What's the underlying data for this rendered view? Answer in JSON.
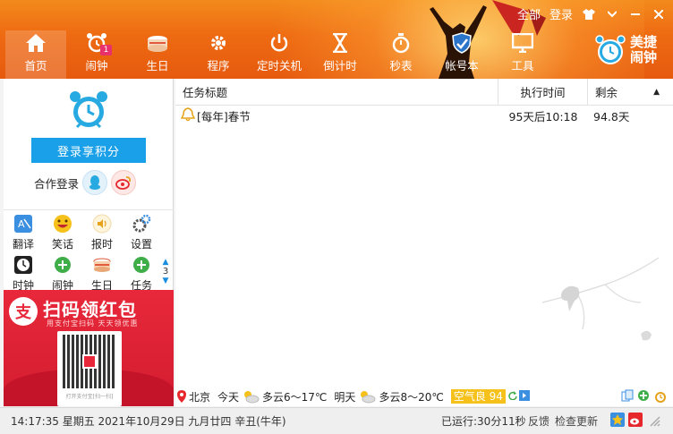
{
  "titlebar": {
    "all": "全部",
    "login": "登录"
  },
  "nav": {
    "items": [
      {
        "label": "首页",
        "icon": "home-icon"
      },
      {
        "label": "闹钟",
        "icon": "alarm-clock-icon",
        "badge": "1"
      },
      {
        "label": "生日",
        "icon": "cake-icon"
      },
      {
        "label": "程序",
        "icon": "gear-icon"
      },
      {
        "label": "定时关机",
        "icon": "power-icon"
      },
      {
        "label": "倒计时",
        "icon": "hourglass-icon"
      },
      {
        "label": "秒表",
        "icon": "stopwatch-icon"
      },
      {
        "label": "帐号本",
        "icon": "shield-icon"
      },
      {
        "label": "工具",
        "icon": "monitor-icon"
      }
    ],
    "brand": "美捷闹钟"
  },
  "left": {
    "login_button": "登录享积分",
    "coop_login": "合作登录",
    "tools_row1": [
      {
        "label": "翻译",
        "icon": "translate-icon"
      },
      {
        "label": "笑话",
        "icon": "smiley-icon"
      },
      {
        "label": "报时",
        "icon": "speaker-icon"
      },
      {
        "label": "设置",
        "icon": "settings-icon"
      }
    ],
    "tools_row2": [
      {
        "label": "时钟",
        "icon": "clock-icon"
      },
      {
        "label": "闹钟",
        "icon": "plus-circle-icon"
      },
      {
        "label": "生日",
        "icon": "cake-icon"
      },
      {
        "label": "任务",
        "icon": "plus-circle-icon"
      }
    ],
    "page_number": "3",
    "ad": {
      "title": "扫码领红包",
      "subtitle": "用支付宝扫码 天天领优惠",
      "caption": "打开支付宝[扫一扫]",
      "logo": "支"
    }
  },
  "table": {
    "headers": {
      "title": "任务标题",
      "time": "执行时间",
      "remaining": "剩余"
    },
    "rows": [
      {
        "title": "[每年]春节",
        "time": "95天后10:18",
        "remaining": "94.8天"
      }
    ]
  },
  "weather": {
    "city": "北京",
    "today_label": "今天",
    "today": "多云6～17℃",
    "tomorrow_label": "明天",
    "tomorrow": "多云8～20℃",
    "air_quality": "空气良 94"
  },
  "status": {
    "datetime": "14:17:35 星期五 2021年10月29日 九月廿四 辛丑(牛年)",
    "runtime": "已运行:30分11秒",
    "feedback": "反馈",
    "check_update": "检查更新"
  },
  "colors": {
    "header": "#ee6a12",
    "accent": "#1aa0e8",
    "ad": "#e8283a"
  }
}
